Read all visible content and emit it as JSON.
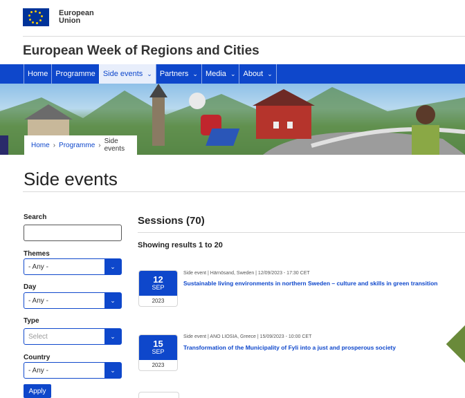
{
  "header": {
    "org_line1": "European",
    "org_line2": "Union",
    "site_title": "European Week of Regions and Cities"
  },
  "nav": {
    "items": [
      {
        "label": "Home",
        "dropdown": false,
        "active": false
      },
      {
        "label": "Programme",
        "dropdown": false,
        "active": false
      },
      {
        "label": "Side events",
        "dropdown": true,
        "active": true
      },
      {
        "label": "Partners",
        "dropdown": true,
        "active": false
      },
      {
        "label": "Media",
        "dropdown": true,
        "active": false
      },
      {
        "label": "About",
        "dropdown": true,
        "active": false
      }
    ]
  },
  "breadcrumb": {
    "items": [
      "Home",
      "Programme"
    ],
    "current": "Side events"
  },
  "page_title": "Side events",
  "filters": {
    "search_label": "Search",
    "themes_label": "Themes",
    "themes_value": "- Any -",
    "day_label": "Day",
    "day_value": "- Any -",
    "type_label": "Type",
    "type_placeholder": "Select",
    "country_label": "Country",
    "country_value": "- Any -",
    "apply_label": "Apply"
  },
  "sessions": {
    "title": "Sessions (70)",
    "results_text": "Showing results 1 to 20"
  },
  "events": [
    {
      "day": "12",
      "month": "SEP",
      "year": "2023",
      "meta": "Side event | Härnösand, Sweden | 12/09/2023 - 17:30 CET",
      "title": "Sustainable living environments in northern Sweden – culture and skills in green transition"
    },
    {
      "day": "15",
      "month": "SEP",
      "year": "2023",
      "meta": "Side event | ANO LIOSIA, Greece | 15/09/2023 - 10:00 CET",
      "title": "Transformation of the Municipality of Fyli into a just and prosperous society"
    }
  ],
  "colors": {
    "primary": "#0e47cb",
    "eu_blue": "#003399",
    "eu_gold": "#ffcc00"
  }
}
